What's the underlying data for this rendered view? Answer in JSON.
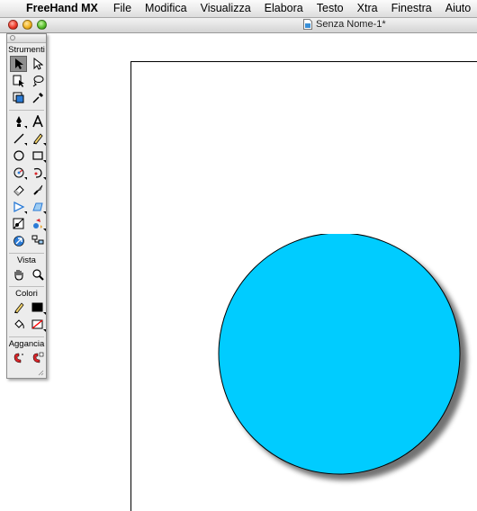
{
  "menubar": {
    "app_name": "FreeHand MX",
    "items": [
      "File",
      "Modifica",
      "Visualizza",
      "Elabora",
      "Testo",
      "Xtra",
      "Finestra",
      "Aiuto"
    ]
  },
  "document": {
    "title": "Senza Nome-1*"
  },
  "palette": {
    "sections": {
      "tools": "Strumenti",
      "view": "Vista",
      "colors": "Colori",
      "snap": "Aggancia"
    }
  },
  "canvas": {
    "shape": "circle",
    "fill_color": "#00ccff",
    "stroke_color": "#000000",
    "shadow": true
  },
  "colors": {
    "circle_fill": "#00ccff",
    "fill_swatch": "#000000",
    "none_swatch": "#ff0000"
  }
}
